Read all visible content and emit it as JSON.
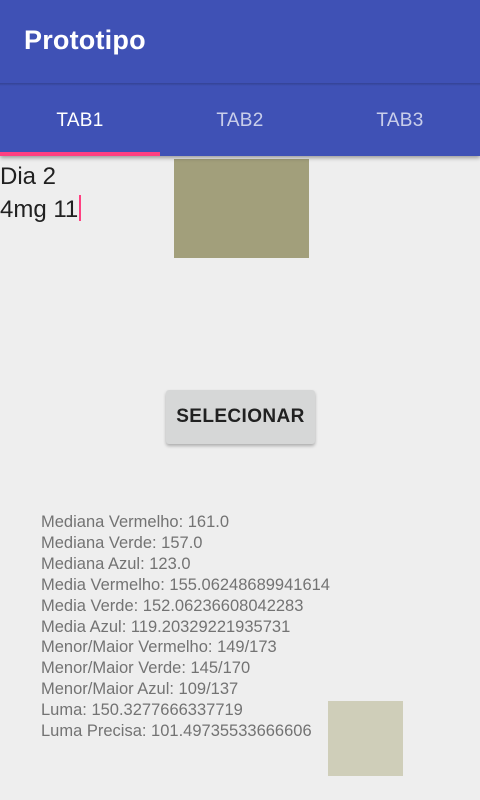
{
  "app": {
    "title": "Prototipo",
    "primary_color": "#3f51b5",
    "accent_color": "#ff4081"
  },
  "tabs": [
    {
      "label": "TAB1",
      "selected": true
    },
    {
      "label": "TAB2",
      "selected": false
    },
    {
      "label": "TAB3",
      "selected": false
    }
  ],
  "input": {
    "line1": "Dia 2",
    "line2": "4mg 11"
  },
  "sample_image": {
    "color": "#a29f7b"
  },
  "select_button": {
    "label": "SELECIONAR"
  },
  "stats": [
    "Mediana Vermelho: 161.0",
    "Mediana Verde: 157.0",
    "Mediana Azul: 123.0",
    "Media Vermelho: 155.06248689941614",
    "Media Verde: 152.06236608042283",
    "Media Azul: 119.20329221935731",
    "Menor/Maior Vermelho: 149/173",
    "Menor/Maior Verde: 145/170",
    "Menor/Maior Azul: 109/137",
    "Luma: 150.3277666337719",
    "Luma Precisa: 101.49735533666606"
  ],
  "color_swatch": {
    "color": "#cfceb9"
  }
}
